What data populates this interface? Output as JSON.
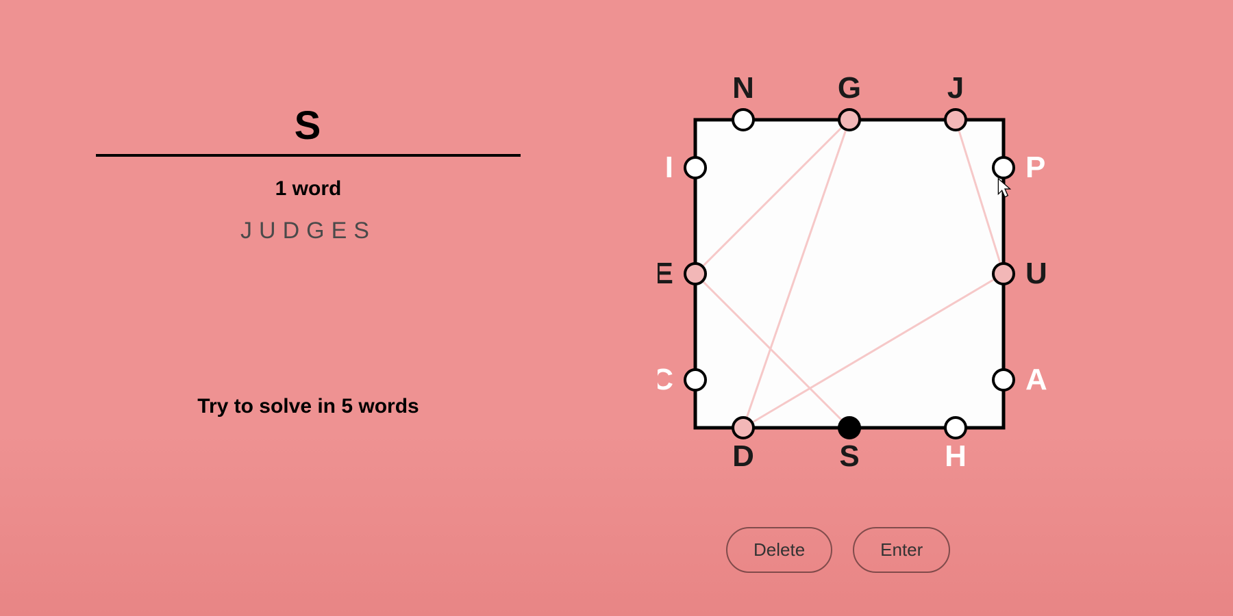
{
  "input": {
    "current": "S",
    "word_count_label": "1 word",
    "found_words": [
      "JUDGES"
    ]
  },
  "hint": "Try to solve in 5 words",
  "board": {
    "top": [
      "N",
      "G",
      "J"
    ],
    "right": [
      "P",
      "U",
      "A"
    ],
    "bottom": [
      "D",
      "S",
      "H"
    ],
    "left": [
      "I",
      "E",
      "C"
    ],
    "selected": "S",
    "highlighted": [
      "P",
      "H",
      "I",
      "C",
      "A"
    ],
    "used_dots": [
      "G",
      "E",
      "D",
      "S",
      "U",
      "J"
    ],
    "path_previous": [
      "J",
      "U",
      "D",
      "G",
      "E",
      "S"
    ]
  },
  "buttons": {
    "delete": "Delete",
    "enter": "Enter"
  }
}
